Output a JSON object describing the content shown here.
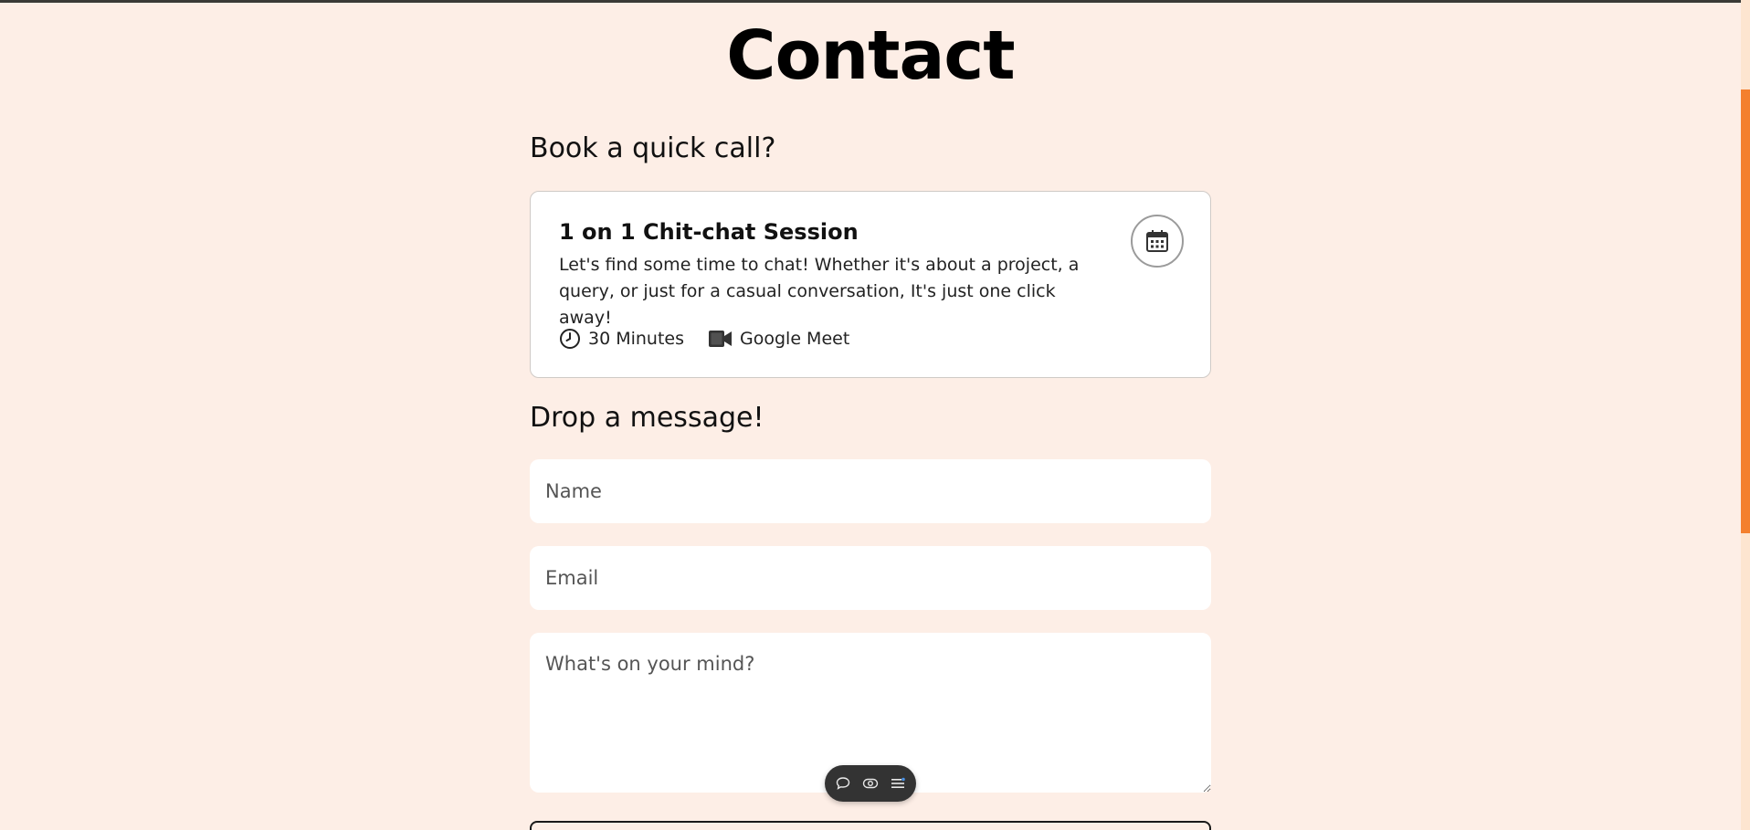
{
  "page": {
    "title": "Contact"
  },
  "booking": {
    "heading": "Book a quick call?",
    "card": {
      "title": "1 on 1 Chit-chat Session",
      "description": "Let's find some time to chat! Whether it's about a project, a query, or just for a casual conversation, It's just one click away!",
      "duration": "30 Minutes",
      "platform": "Google Meet",
      "duration_icon": "clock-icon",
      "platform_icon": "video-camera-icon",
      "action_icon": "calendar-icon"
    }
  },
  "message": {
    "heading": "Drop a message!",
    "name_placeholder": "Name",
    "email_placeholder": "Email",
    "message_placeholder": "What's on your mind?"
  },
  "toolbar": {
    "icons": [
      "comment-icon",
      "eye-toggle-icon",
      "menu-icon"
    ]
  },
  "colors": {
    "background": "#fdeee6",
    "card": "#ffffff",
    "accent": "#f4802e",
    "toolbar": "#333333"
  }
}
